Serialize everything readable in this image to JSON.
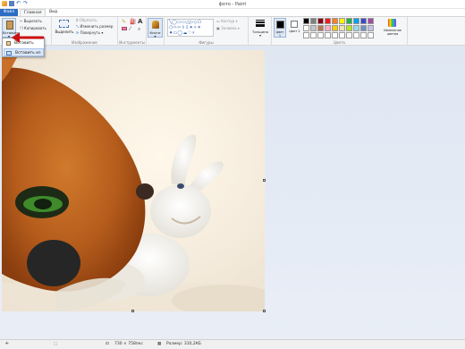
{
  "window": {
    "title": "фото - Paint"
  },
  "tabs": {
    "file": "Файл",
    "home": "Главная",
    "view": "Вид"
  },
  "ribbon": {
    "paste_label": "Вставить",
    "cut_label": "Вырезать",
    "copy_label": "Копировать",
    "select_label": "Выделить",
    "crop_label": "Обрезать",
    "resize_label": "Изменить размер",
    "rotate_label": "Повернуть ▾",
    "image_group": "Изображение",
    "tools_group": "Инструменты",
    "brushes_label": "Кисти",
    "shapes_group": "Фигуры",
    "outline_label": "Контур ▾",
    "fill_label": "Заливка ▾",
    "size_label": "Толщина",
    "color1_label": "Цвет 1",
    "color2_label": "Цвет 2",
    "colors_group": "Цвета",
    "edit_colors_label": "Изменение цветов"
  },
  "palette": {
    "row1": [
      "#000000",
      "#7f7f7f",
      "#880015",
      "#ed1c24",
      "#ff7f27",
      "#fff200",
      "#22b14c",
      "#00a2e8",
      "#3f48cc",
      "#a349a4"
    ],
    "row2": [
      "#ffffff",
      "#c3c3c3",
      "#b97a57",
      "#ffaec9",
      "#ffc90e",
      "#efe4b0",
      "#b5e61d",
      "#99d9ea",
      "#7092be",
      "#c8bfe7"
    ],
    "row3": [
      "#ffffff",
      "#ffffff",
      "#ffffff",
      "#ffffff",
      "#ffffff",
      "#ffffff",
      "#ffffff",
      "#ffffff",
      "#ffffff",
      "#ffffff"
    ]
  },
  "paste_menu": {
    "item1": "Вставить",
    "item2": "Вставить из"
  },
  "status": {
    "dimensions": "730 × 758пкс",
    "filesize": "Размер: 310,2КБ"
  }
}
